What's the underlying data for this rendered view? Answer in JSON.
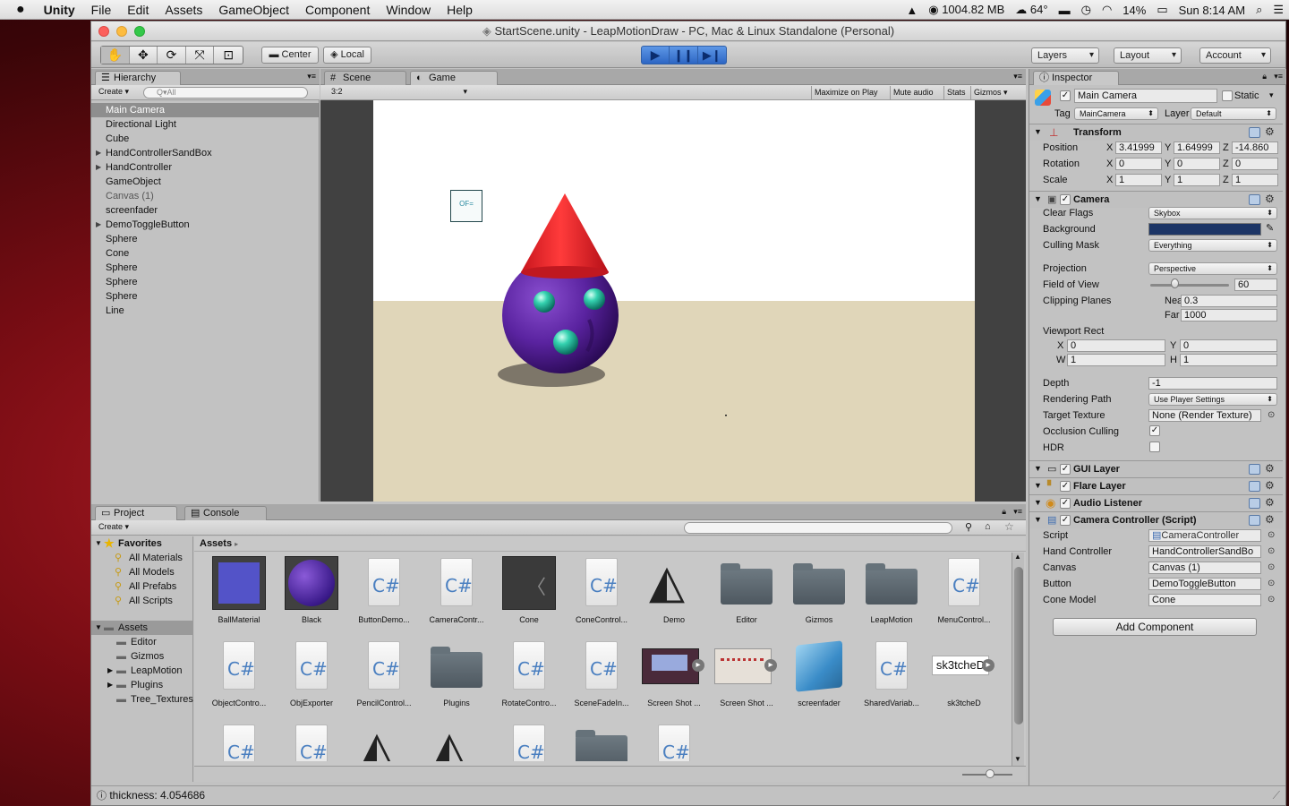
{
  "menubar": {
    "app": "Unity",
    "items": [
      "File",
      "Edit",
      "Assets",
      "GameObject",
      "Component",
      "Window",
      "Help"
    ],
    "memory": "1004.82 MB",
    "weather": "64°",
    "battery": "14%",
    "clock": "Sun 8:14 AM"
  },
  "window": {
    "title": "StartScene.unity - LeapMotionDraw - PC, Mac & Linux Standalone (Personal)"
  },
  "toolbar": {
    "center": "Center",
    "local": "Local",
    "layers": "Layers",
    "layout": "Layout",
    "account": "Account"
  },
  "hierarchy": {
    "tab": "Hierarchy",
    "create": "Create",
    "search_placeholder": "Q▾All",
    "items": [
      {
        "label": "Main Camera",
        "selected": true
      },
      {
        "label": "Directional Light"
      },
      {
        "label": "Cube"
      },
      {
        "label": "HandControllerSandBox",
        "expandable": true
      },
      {
        "label": "HandController",
        "expandable": true
      },
      {
        "label": "GameObject"
      },
      {
        "label": "Canvas (1)",
        "dim": true
      },
      {
        "label": "screenfader"
      },
      {
        "label": "DemoToggleButton",
        "expandable": true
      },
      {
        "label": "Sphere"
      },
      {
        "label": "Cone"
      },
      {
        "label": "Sphere"
      },
      {
        "label": "Sphere"
      },
      {
        "label": "Sphere"
      },
      {
        "label": "Line"
      }
    ]
  },
  "game": {
    "tab_scene": "Scene",
    "tab_game": "Game",
    "aspect": "3:2",
    "maximize": "Maximize on Play",
    "mute": "Mute audio",
    "stats": "Stats",
    "gizmos": "Gizmos",
    "toggle_text": "OF=",
    "sky_color": "#ffffff",
    "floor_color": "#e0d6b9"
  },
  "inspector": {
    "tab": "Inspector",
    "object_name": "Main Camera",
    "static_label": "Static",
    "tag_label": "Tag",
    "tag_value": "MainCamera",
    "layer_label": "Layer",
    "layer_value": "Default",
    "transform": {
      "title": "Transform",
      "position_label": "Position",
      "rotation_label": "Rotation",
      "scale_label": "Scale",
      "position": [
        "3.41999",
        "1.64999",
        "-14.860"
      ],
      "rotation": [
        "0",
        "0",
        "0"
      ],
      "scale": [
        "1",
        "1",
        "1"
      ]
    },
    "camera": {
      "title": "Camera",
      "clear_flags_label": "Clear Flags",
      "clear_flags": "Skybox",
      "background_label": "Background",
      "background_color": "#1c3566",
      "culling_mask_label": "Culling Mask",
      "culling_mask": "Everything",
      "projection_label": "Projection",
      "projection": "Perspective",
      "fov_label": "Field of View",
      "fov": "60",
      "clipping_label": "Clipping Planes",
      "near_label": "Near",
      "near": "0.3",
      "far_label": "Far",
      "far": "1000",
      "viewport_label": "Viewport Rect",
      "vx": "0",
      "vy": "0",
      "vw": "1",
      "vh": "1",
      "depth_label": "Depth",
      "depth": "-1",
      "rendering_label": "Rendering Path",
      "rendering": "Use Player Settings",
      "target_label": "Target Texture",
      "target": "None (Render Texture)",
      "occlusion_label": "Occlusion Culling",
      "hdr_label": "HDR"
    },
    "gui_layer": "GUI Layer",
    "flare_layer": "Flare Layer",
    "audio_listener": "Audio Listener",
    "script_comp": {
      "title": "Camera Controller (Script)",
      "script_label": "Script",
      "script": "CameraController",
      "hand_label": "Hand Controller",
      "hand": "HandControllerSandBo",
      "canvas_label": "Canvas",
      "canvas": "Canvas (1)",
      "button_label": "Button",
      "button": "DemoToggleButton",
      "cone_label": "Cone Model",
      "cone": "Cone"
    },
    "add_component": "Add Component"
  },
  "project": {
    "tab_project": "Project",
    "tab_console": "Console",
    "create": "Create",
    "favorites": "Favorites",
    "fav_items": [
      "All Materials",
      "All Models",
      "All Prefabs",
      "All Scripts"
    ],
    "assets_root": "Assets",
    "asset_folders": [
      "Editor",
      "Gizmos",
      "LeapMotion",
      "Plugins",
      "Tree_Textures"
    ],
    "breadcrumb": "Assets",
    "assets_row1": [
      "BallMaterial",
      "Black",
      "ButtonDemo...",
      "CameraContr...",
      "Cone",
      "ConeControl...",
      "Demo",
      "Editor",
      "Gizmos",
      "LeapMotion",
      "MenuControl..."
    ],
    "assets_row2": [
      "ObjectContro...",
      "ObjExporter",
      "PencilControl...",
      "Plugins",
      "RotateContro...",
      "SceneFadeIn...",
      "Screen Shot ...",
      "Screen Shot ...",
      "screenfader",
      "SharedVariab...",
      "sk3tcheD"
    ],
    "sk3tched_icon_text": "sk3tcheD"
  },
  "statusbar": {
    "text": "thickness: 4.054686"
  }
}
